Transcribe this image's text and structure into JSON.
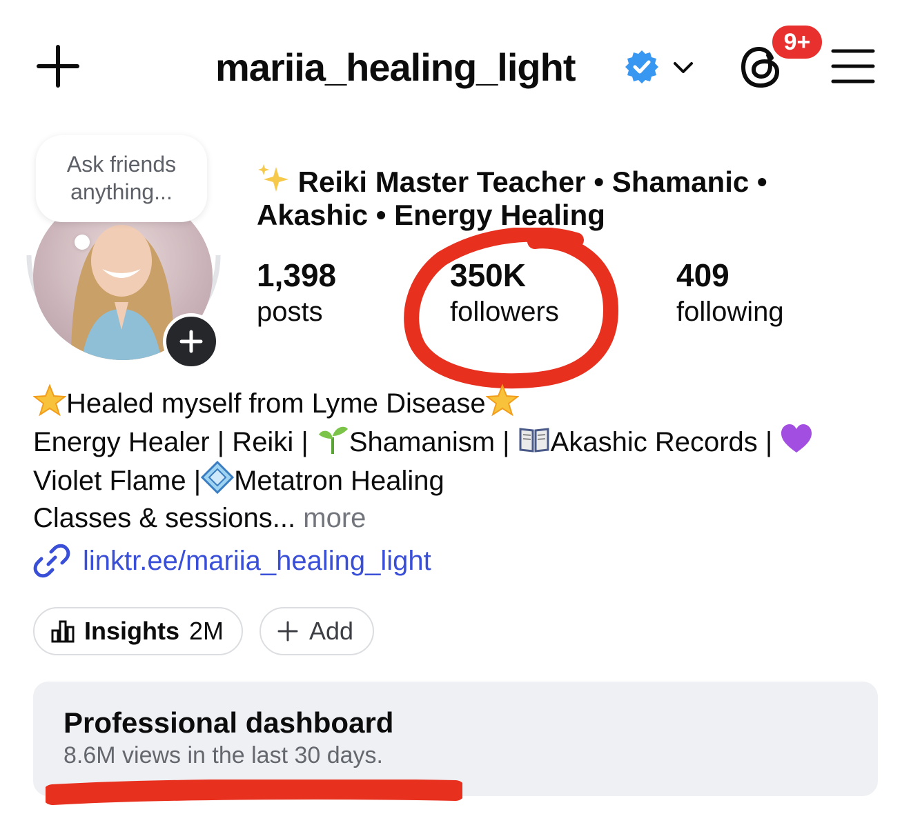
{
  "header": {
    "username": "mariia_healing_light",
    "notification_badge": "9+",
    "accent_color": "#3897f0",
    "badge_color": "#e8312f"
  },
  "avatar": {
    "note_prompt": "Ask friends anything..."
  },
  "profile": {
    "category_line1": "Reiki Master Teacher • Shamanic •",
    "category_line2": "Akashic • Energy Healing"
  },
  "stats": {
    "posts_count": "1,398",
    "posts_label": "posts",
    "followers_count": "350K",
    "followers_label": "followers",
    "following_count": "409",
    "following_label": "following"
  },
  "bio": {
    "line1": "Healed myself from Lyme Disease",
    "line2_a": "Energy Healer | Reiki | ",
    "line2_b": "Shamanism | ",
    "line2_c": "Akashic Records | ",
    "line3_a": "Violet Flame |",
    "line3_b": "Metatron Healing",
    "line4": "Classes & sessions...",
    "more_label": "more",
    "link": "linktr.ee/mariia_healing_light"
  },
  "actions": {
    "insights_label": "Insights",
    "insights_value": "2M",
    "add_label": "Add"
  },
  "dashboard": {
    "title": "Professional dashboard",
    "subtitle": "8.6M views in the last 30 days."
  }
}
